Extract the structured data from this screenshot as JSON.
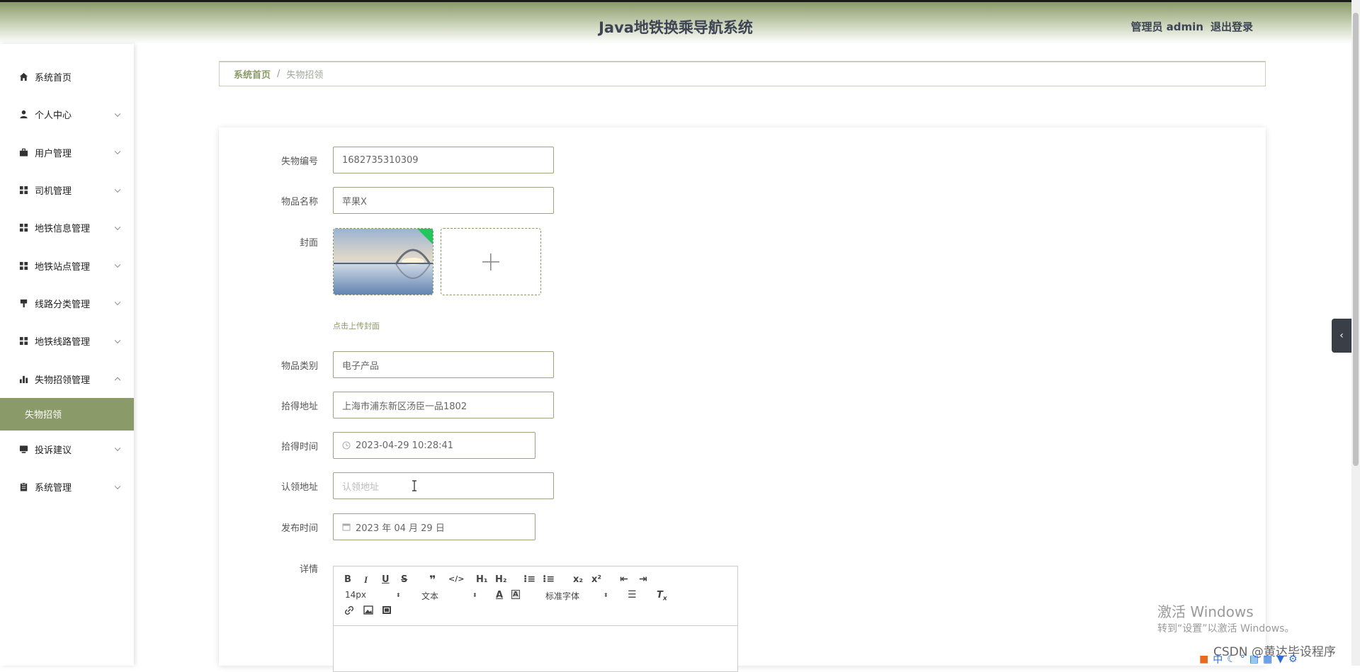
{
  "header": {
    "title": "Java地铁换乘导航系统",
    "user": "管理员 admin",
    "logout": "退出登录"
  },
  "sidebar": {
    "items": [
      {
        "label": "系统首页",
        "icon": "home-icon",
        "expandable": false
      },
      {
        "label": "个人中心",
        "icon": "user-icon",
        "expandable": true
      },
      {
        "label": "用户管理",
        "icon": "briefcase-icon",
        "expandable": true
      },
      {
        "label": "司机管理",
        "icon": "grid-icon",
        "expandable": true
      },
      {
        "label": "地铁信息管理",
        "icon": "grid-icon",
        "expandable": true
      },
      {
        "label": "地铁站点管理",
        "icon": "grid-icon",
        "expandable": true
      },
      {
        "label": "线路分类管理",
        "icon": "brush-icon",
        "expandable": true
      },
      {
        "label": "地铁线路管理",
        "icon": "grid-icon",
        "expandable": true
      },
      {
        "label": "失物招领管理",
        "icon": "bar-chart-icon",
        "expandable": true,
        "expanded": true
      },
      {
        "label": "投诉建议",
        "icon": "monitor-icon",
        "expandable": true
      },
      {
        "label": "系统管理",
        "icon": "clipboard-icon",
        "expandable": true
      }
    ],
    "active_sub": "失物招领"
  },
  "breadcrumb": {
    "home": "系统首页",
    "separator": "/",
    "current": "失物招领"
  },
  "form": {
    "code_label": "失物编号",
    "code_value": "1682735310309",
    "name_label": "物品名称",
    "name_value": "苹果X",
    "cover_label": "封面",
    "cover_hint": "点击上传封面",
    "category_label": "物品类别",
    "category_value": "电子产品",
    "address_label": "拾得地址",
    "address_value": "上海市浦东新区汤臣一品1802",
    "found_time_label": "拾得时间",
    "found_time_value": "2023-04-29 10:28:41",
    "claim_label": "认领地址",
    "claim_placeholder": "认领地址",
    "publish_label": "发布时间",
    "publish_value": "2023 年 04 月 29 日",
    "detail_label": "详情"
  },
  "editor": {
    "font_size": "14px",
    "paragraph": "文本",
    "font_family": "标准字体"
  },
  "watermark": {
    "line1": "激活 Windows",
    "line2": "转到“设置”以激活 Windows。"
  },
  "csdn": "CSDN @黄达毕设程序"
}
